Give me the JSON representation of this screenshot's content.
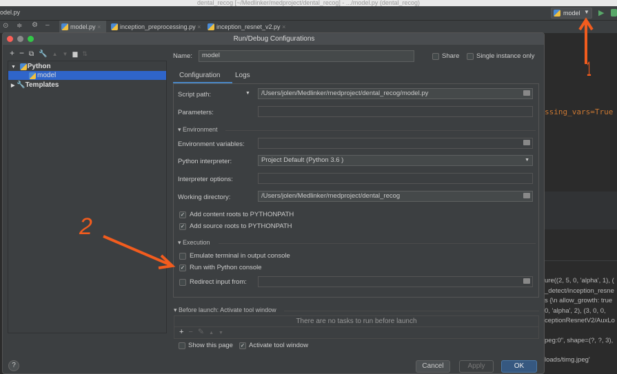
{
  "window": {
    "title": "dental_recog [~/Medlinker/medproject/dental_recog] - .../model.py (dental_recog)"
  },
  "navbar": {
    "file": "odel.py",
    "run_config": "model"
  },
  "tabs": [
    {
      "label": "model.py",
      "active": true
    },
    {
      "label": "inception_preprocessing.py"
    },
    {
      "label": "inception_resnet_v2.py"
    }
  ],
  "dialog": {
    "title": "Run/Debug Configurations",
    "tree": {
      "python": "Python",
      "model": "model",
      "templates": "Templates"
    },
    "name_label": "Name:",
    "name_value": "model",
    "share": "Share",
    "single_instance": "Single instance only",
    "tabs": [
      "Configuration",
      "Logs"
    ],
    "script_path_label": "Script path:",
    "script_path": "/Users/jolen/Medlinker/medproject/dental_recog/model.py",
    "parameters_label": "Parameters:",
    "environment": "Environment",
    "env_vars_label": "Environment variables:",
    "interpreter_label": "Python interpreter:",
    "interpreter": "Project Default (Python 3.6 )",
    "interp_options_label": "Interpreter options:",
    "workdir_label": "Working directory:",
    "workdir": "/Users/jolen/Medlinker/medproject/dental_recog",
    "add_content_roots": "Add content roots to PYTHONPATH",
    "add_source_roots": "Add source roots to PYTHONPATH",
    "execution": "Execution",
    "emulate_terminal": "Emulate terminal in output console",
    "run_python_console": "Run with Python console",
    "redirect_input": "Redirect input from:",
    "before_launch": "Before launch: Activate tool window",
    "no_tasks": "There are no tasks to run before launch",
    "show_page": "Show this page",
    "activate_tool": "Activate tool window",
    "cancel": "Cancel",
    "apply": "Apply",
    "ok": "OK",
    "checks": {
      "add_content_roots": true,
      "add_source_roots": true,
      "emulate_terminal": false,
      "run_python_console": true,
      "redirect_input": false,
      "show_page": false,
      "activate_tool": true,
      "share": false,
      "single_instance": false
    }
  },
  "editor": {
    "code": "ssing_vars=True"
  },
  "console": [
    "ure((2, 5, 0, 'alpha', 1), (",
    "_detect/inception_resne",
    "s {\\n  allow_growth: true",
    "0, 'alpha', 2), (3, 0, 0,",
    "ceptionResnetV2/AuxLo",
    "peg:0\", shape=(?, ?, 3),",
    "loads/timg.jpeg'"
  ],
  "annotations": {
    "one": "1",
    "two": "2"
  },
  "colors": {
    "accent": "#2f65ca",
    "annotation": "#f25c1e",
    "ok": "#365880"
  }
}
